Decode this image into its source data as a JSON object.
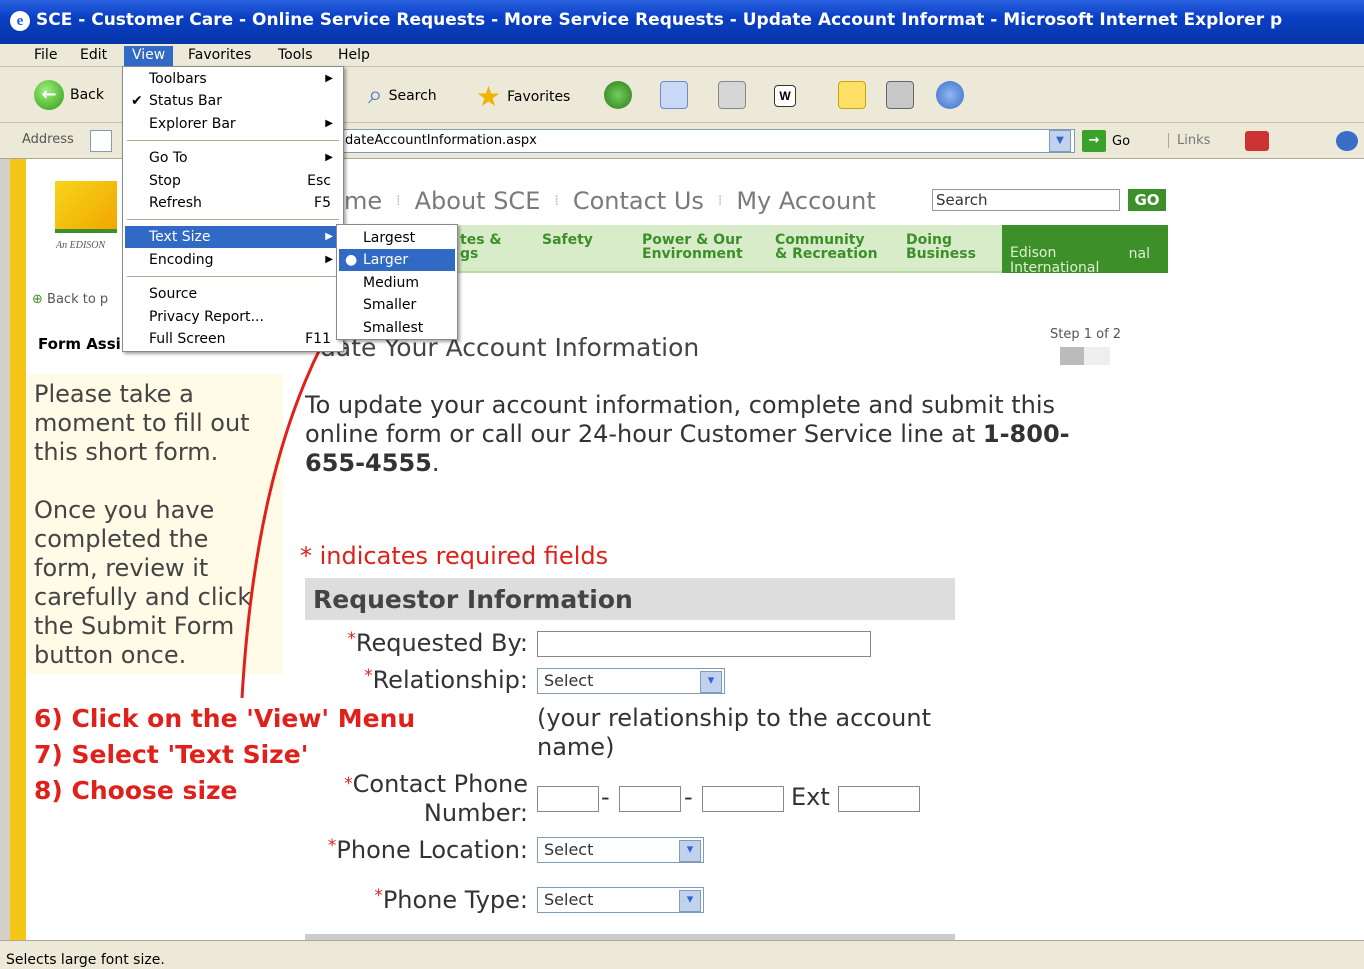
{
  "window": {
    "title": "SCE - Customer Care - Online Service Requests - More Service Requests - Update Account Informat - Microsoft Internet Explorer p"
  },
  "menubar": {
    "items": [
      "File",
      "Edit",
      "View",
      "Favorites",
      "Tools",
      "Help"
    ]
  },
  "toolbar": {
    "back": "Back",
    "search": "Search",
    "favorites": "Favorites"
  },
  "address": {
    "label": "Address",
    "url": "dateAccountInformation.aspx",
    "go": "Go",
    "links": "Links"
  },
  "view_menu": {
    "toolbars": "Toolbars",
    "status_bar": "Status Bar",
    "explorer_bar": "Explorer Bar",
    "go_to": "Go To",
    "stop": "Stop",
    "stop_key": "Esc",
    "refresh": "Refresh",
    "refresh_key": "F5",
    "text_size": "Text Size",
    "encoding": "Encoding",
    "source": "Source",
    "privacy": "Privacy Report...",
    "full_screen": "Full Screen",
    "full_screen_key": "F11"
  },
  "text_size_menu": {
    "items": [
      "Largest",
      "Larger",
      "Medium",
      "Smaller",
      "Smallest"
    ],
    "selected": "Larger"
  },
  "site": {
    "edison_label": "An EDISON",
    "nav_top": [
      "me",
      "About SCE",
      "Contact Us",
      "My Account"
    ],
    "search_placeholder": "Search",
    "search_go": "GO",
    "nav_green": [
      "tes &\ngs",
      "Safety",
      "Power & Our\nEnvironment",
      "Community\n& Recreation",
      "Doing\nBusiness"
    ],
    "edison_intl": "Edison\nInternational",
    "edison_intl_tail": "nal",
    "back_link": "Back to p",
    "form_assist": "Form Assi",
    "step": "Step 1 of 2",
    "page_title": "date Your Account Information",
    "instructions_1": "Please take a moment to fill out this short form.",
    "instructions_2": "Once you have completed the form, review it carefully and click the Submit Form button once.",
    "intro_text": "To update your account information, complete and submit this online form or call our 24-hour Customer Service line at ",
    "phone": "1-800-655-4555",
    "intro_end": ".",
    "required_note": "* indicates required fields",
    "section_title": "Requestor Information",
    "fields": {
      "requested_by": "Requested By:",
      "relationship": "Relationship:",
      "relationship_note": "(your relationship to the account name)",
      "contact_phone_1": "Contact Phone",
      "contact_phone_2": "Number:",
      "ext": "Ext",
      "phone_location": "Phone Location:",
      "phone_type": "Phone Type:",
      "select": "Select",
      "asterisk": "*"
    }
  },
  "tutorial": {
    "step6a": "6)  Click on the ",
    "step6b": "'View'",
    "step6c": " Menu",
    "step7a": "7)  Select ",
    "step7b": "'Text Size'",
    "step8": "8)  Choose size"
  },
  "status": {
    "text": "Selects large font size."
  },
  "colors": {
    "accent_red": "#e0201a",
    "sce_green": "#3d8f2a",
    "menu_highlight": "#316ac5"
  }
}
